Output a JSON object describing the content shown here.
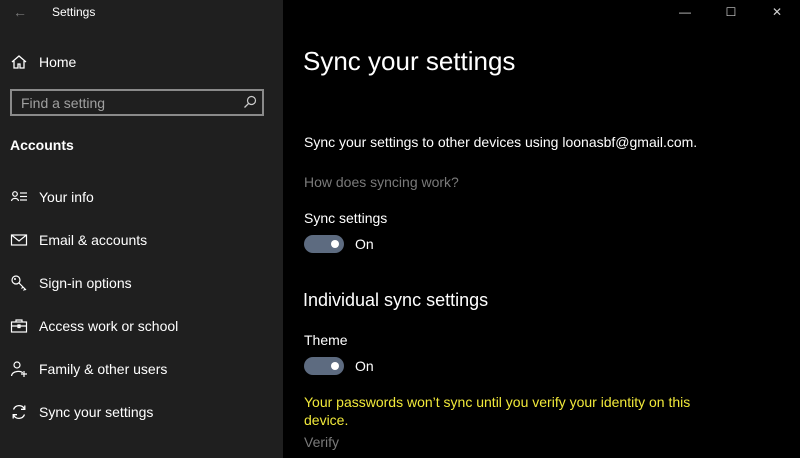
{
  "window": {
    "title": "Settings",
    "controls": {
      "minimize": "—",
      "maximize": "☐",
      "close": "✕"
    }
  },
  "sidebar": {
    "back_glyph": "←",
    "home_label": "Home",
    "search_placeholder": "Find a setting",
    "section_title": "Accounts",
    "items": [
      {
        "label": "Your info",
        "icon": "person-card-icon"
      },
      {
        "label": "Email & accounts",
        "icon": "mail-icon"
      },
      {
        "label": "Sign-in options",
        "icon": "key-icon"
      },
      {
        "label": "Access work or school",
        "icon": "briefcase-icon"
      },
      {
        "label": "Family & other users",
        "icon": "person-add-icon"
      },
      {
        "label": "Sync your settings",
        "icon": "sync-icon"
      }
    ]
  },
  "main": {
    "title": "Sync your settings",
    "description": "Sync your settings to other devices using loonasbf@gmail.com.",
    "how_link": "How does syncing work?",
    "sync_settings": {
      "label": "Sync settings",
      "state": "On"
    },
    "individual_heading": "Individual sync settings",
    "theme": {
      "label": "Theme",
      "state": "On"
    },
    "warning": "Your passwords won’t sync until you verify your identity on this device.",
    "verify_link": "Verify"
  },
  "colors": {
    "sidebar_bg": "#1f1f1f",
    "main_bg": "#000000",
    "toggle_on": "#5d6b80",
    "warning_text": "#f1e93a",
    "muted_link": "#7a7a7a"
  }
}
